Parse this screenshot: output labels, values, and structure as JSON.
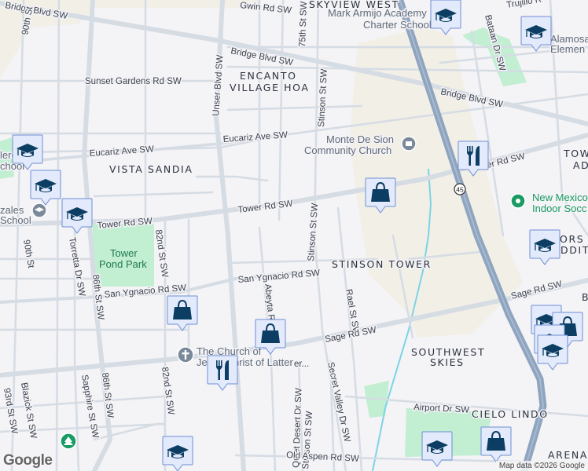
{
  "map": {
    "credit": "Map data ©2026 Google",
    "logo": "Google",
    "colors": {
      "background": "#f4f3f6",
      "road": "#d5dce4",
      "highway": "#8ea4bf",
      "park": "#c2eed2",
      "tan": "#f2efe6",
      "water": "#7dd3e8",
      "pin_fill": "#e3eafb",
      "pin_icon": "#0b3e62"
    },
    "highway_shield": "45",
    "roads": {
      "bridge_1": "Bridge Blvd SW",
      "bridge_2": "Bridge Blvd SW",
      "bridge_3": "Bridge Blvd SW",
      "gwin": "Gwin Rd SW",
      "trujillo": "Trujillo R",
      "st90_top": "90th St",
      "st90_bot": "90th St",
      "unser": "Unser Blvd SW",
      "sunset": "Sunset Gardens Rd SW",
      "eucariz_1": "Eucariz Ave SW",
      "eucariz_2": "Eucariz Ave SW",
      "tower_1": "Tower Rd SW",
      "tower_2": "Tower Rd SW",
      "tower_3": "er Rd SW",
      "st75": "75th St SW",
      "stinson_1": "Stinson St SW",
      "stinson_2": "Stinson St SW",
      "stinson_3": "Stinson St SW",
      "bataan": "Bataan Dr SW",
      "torretta": "Torretta Dr SW",
      "st82_1": "82nd St SW",
      "st82_2": "82nd St SW",
      "st86_1": "86th St SW",
      "st86_2": "86th St SW",
      "san_ygnacio_1": "San Ygnacio Rd SW",
      "san_ygnacio_2": "San Ygnacio Rd SW",
      "abeyta": "Abeyta R",
      "rael": "Rael St SW",
      "sage_1": "Sage Rd SW",
      "sage_2": "Sage Rd SW",
      "st93": "93rd St SW",
      "blazick": "Blazick St SW",
      "sapphire": "Sapphire St SW",
      "quiet_desert": "Quiet Desert Dr SW",
      "secret_valley": "Secret Valley Dr SW",
      "old_aspen": "Old Aspen Rd SW",
      "airport": "Airport Dr SW"
    },
    "areas": {
      "skyview": "SKYVIEW WEST",
      "encanto_1": "ENCANTO",
      "encanto_2": "VILLAGE HOA",
      "vista": "VISTA SANDIA",
      "stinson_tower": "STINSON TOWER",
      "southwest_1": "SOUTHWEST",
      "southwest_2": "SKIES",
      "cielo": "CIELO LINDO",
      "arenal": "ARENAL",
      "tower_ad_1": "TOWE",
      "tower_ad_2": "AD",
      "ors_1": "ORS",
      "ors_2": "DDITI",
      "b": "B"
    },
    "pois": {
      "mark_armijo_1": "Mark Armijo Academy",
      "mark_armijo_2": "Charter School",
      "alamosa_1": "Alamosa",
      "alamosa_2": "Elemen",
      "monte_1": "Monte De Sion",
      "monte_2": "Community Church",
      "nm_soccer_1": "New Mexico",
      "nm_soccer_2": "Indoor Socc",
      "tower_park_1": "Tower",
      "tower_park_2": "Pond Park",
      "church_lds_1": "The Church of",
      "church_lds_2": "Jesus Christ of Latter",
      "school_left_1": "lero",
      "school_left_2": "chool",
      "gonzales_1": "zales",
      "gonzales_2": "School",
      "truncated": "er..."
    },
    "pins": {
      "school": "school-icon",
      "shopping": "shopping-bag-icon",
      "restaurant": "restaurant-icon"
    }
  }
}
